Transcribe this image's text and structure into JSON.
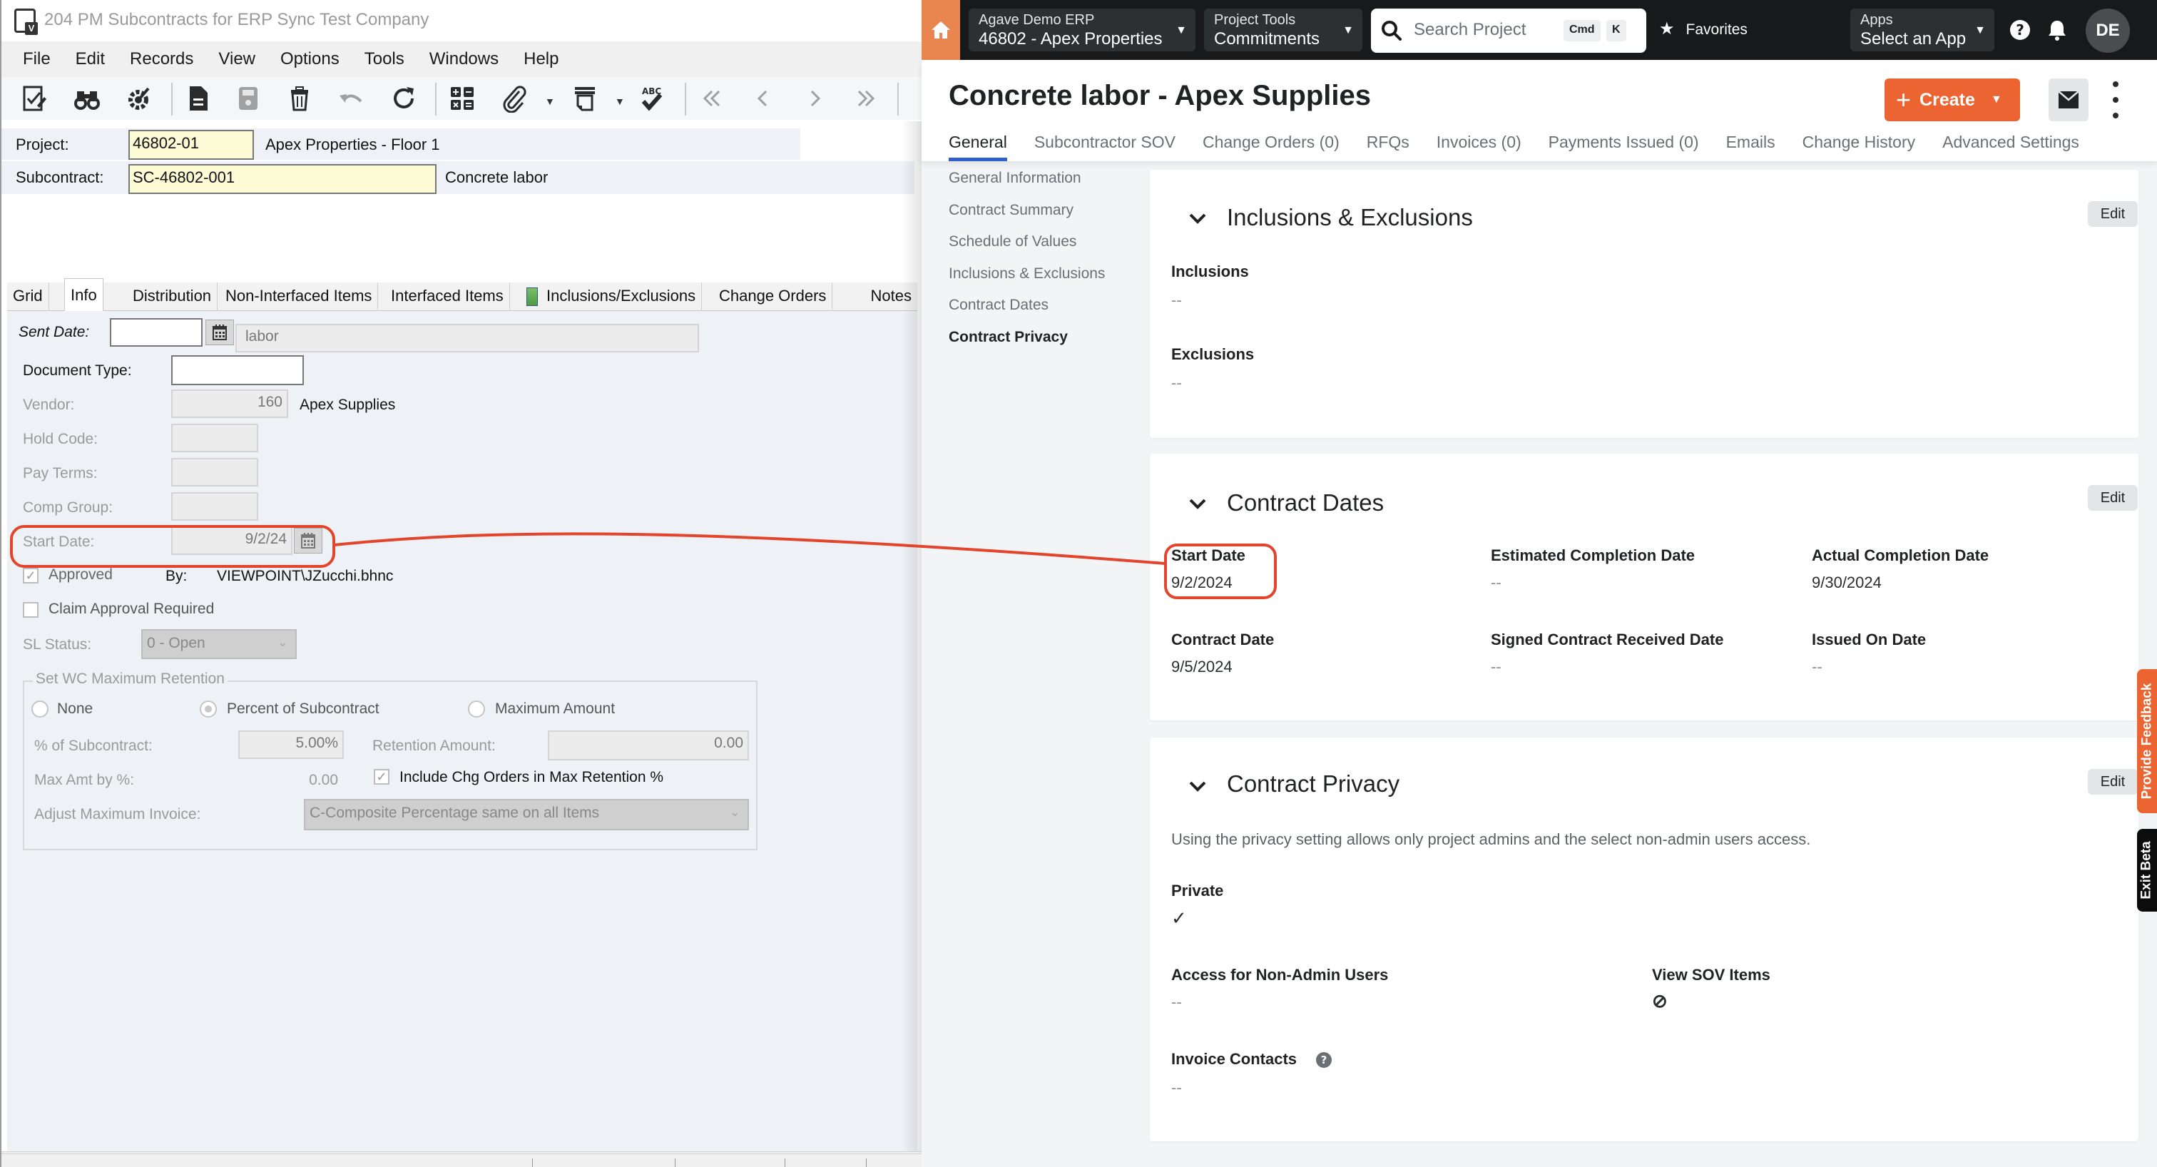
{
  "erp": {
    "window_title": "204 PM Subcontracts for ERP Sync Test Company",
    "menu": [
      "File",
      "Edit",
      "Records",
      "View",
      "Options",
      "Tools",
      "Windows",
      "Help"
    ],
    "header": {
      "project_label": "Project:",
      "project_value": "46802-01",
      "project_desc": "Apex Properties - Floor 1",
      "subcontract_label": "Subcontract:",
      "subcontract_value": "SC-46802-001",
      "subcontract_desc": "Concrete labor"
    },
    "tabs": [
      {
        "label": "Grid"
      },
      {
        "label": "Info",
        "active": true
      },
      {
        "label": "Distribution"
      },
      {
        "label": "Non-Interfaced Items"
      },
      {
        "label": "Interfaced Items"
      },
      {
        "label": "Inclusions/Exclusions"
      },
      {
        "label": "Change Orders"
      },
      {
        "label": "Notes"
      }
    ],
    "info": {
      "sent_date_label": "Sent Date:",
      "sent_date_value": "",
      "description_value": "labor",
      "document_type_label": "Document Type:",
      "document_type_value": "",
      "vendor_label": "Vendor:",
      "vendor_value": "160",
      "vendor_name": "Apex Supplies",
      "hold_code_label": "Hold Code:",
      "pay_terms_label": "Pay Terms:",
      "comp_group_label": "Comp Group:",
      "start_date_label": "Start Date:",
      "start_date_value": "9/2/24",
      "approved_label": "Approved",
      "approved_checked": true,
      "by_label": "By:",
      "by_value": "VIEWPOINT\\JZucchi.bhnc",
      "claim_approval_label": "Claim Approval Required",
      "claim_approval_checked": false,
      "sl_status_label": "SL Status:",
      "sl_status_value": "0 - Open",
      "retention": {
        "group_label": "Set WC Maximum Retention",
        "option_none": "None",
        "option_percent": "Percent of Subcontract",
        "option_max": "Maximum Amount",
        "selected": "Percent of Subcontract",
        "pct_label": "% of Subcontract:",
        "pct_value": "5.00%",
        "retention_amount_label": "Retention Amount:",
        "retention_amount_value": "0.00",
        "max_amt_label": "Max Amt by %:",
        "max_amt_value": "0.00",
        "include_chg_label": "Include Chg Orders in Max Retention %",
        "include_chg_checked": true,
        "adjust_label": "Adjust Maximum Invoice:",
        "adjust_value": "C-Composite Percentage same on all Items"
      }
    }
  },
  "procore": {
    "nav": {
      "company_label": "Agave Demo ERP",
      "project_label": "46802 - Apex Properties",
      "tools_label": "Project Tools",
      "tool_value": "Commitments",
      "search_placeholder": "Search Project",
      "kbd_cmd": "Cmd",
      "kbd_k": "K",
      "favorites": "Favorites",
      "apps_label": "Apps",
      "apps_value": "Select an App",
      "avatar": "DE"
    },
    "page_title": "Concrete labor - Apex Supplies",
    "create_label": "Create",
    "tabs": [
      {
        "label": "General",
        "active": true
      },
      {
        "label": "Subcontractor SOV"
      },
      {
        "label": "Change Orders (0)"
      },
      {
        "label": "RFQs"
      },
      {
        "label": "Invoices (0)"
      },
      {
        "label": "Payments Issued (0)"
      },
      {
        "label": "Emails"
      },
      {
        "label": "Change History"
      },
      {
        "label": "Advanced Settings"
      }
    ],
    "sidebar": [
      {
        "label": "General Information"
      },
      {
        "label": "Contract Summary"
      },
      {
        "label": "Schedule of Values"
      },
      {
        "label": "Inclusions & Exclusions"
      },
      {
        "label": "Contract Dates"
      },
      {
        "label": "Contract Privacy",
        "active": true
      }
    ],
    "edit_label": "Edit",
    "inclusions_card": {
      "title": "Inclusions & Exclusions",
      "inclusions_label": "Inclusions",
      "inclusions_value": "--",
      "exclusions_label": "Exclusions",
      "exclusions_value": "--"
    },
    "dates_card": {
      "title": "Contract Dates",
      "fields": [
        {
          "label": "Start Date",
          "value": "9/2/2024"
        },
        {
          "label": "Estimated Completion Date",
          "value": "--"
        },
        {
          "label": "Actual Completion Date",
          "value": "9/30/2024"
        },
        {
          "label": "Contract Date",
          "value": "9/5/2024"
        },
        {
          "label": "Signed Contract Received Date",
          "value": "--"
        },
        {
          "label": "Issued On Date",
          "value": "--"
        }
      ]
    },
    "privacy_card": {
      "title": "Contract Privacy",
      "description": "Using the privacy setting allows only project admins and the select non-admin users access.",
      "private_label": "Private",
      "private_value": "✓",
      "access_label": "Access for Non-Admin Users",
      "access_value": "--",
      "view_sov_label": "View SOV Items",
      "view_sov_value": "⊘",
      "invoice_contacts_label": "Invoice Contacts",
      "invoice_contacts_value": "--"
    },
    "feedback_label": "Provide Feedback",
    "exit_beta_label": "Exit Beta"
  },
  "colors": {
    "procore_orange": "#ec6431",
    "tab_underline": "#2e61cf",
    "annotation_red": "#e2452b",
    "erp_yellow": "#fdfbd6"
  }
}
